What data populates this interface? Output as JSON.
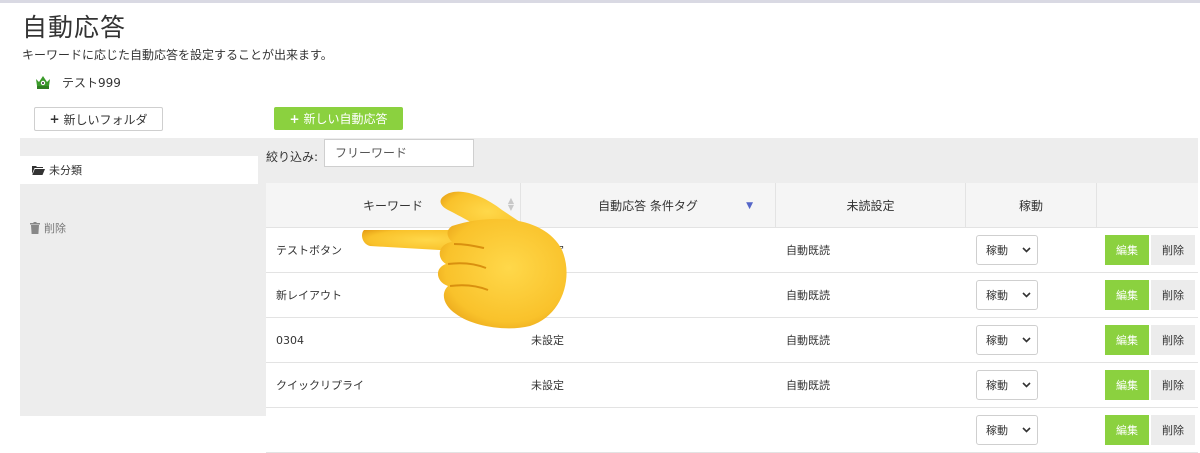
{
  "page": {
    "title": "自動応答",
    "subtitle": "キーワードに応じた自動応答を設定することが出来ます。"
  },
  "account": {
    "name": "テスト999",
    "icon": "green-crown-avatar-icon"
  },
  "toolbar": {
    "new_folder_label": "新しいフォルダ",
    "new_response_label": "新しい自動応答",
    "plus_icon": "+"
  },
  "sidebar": {
    "items": [
      {
        "label": "未分類",
        "icon": "folder-open-icon",
        "selected": true
      },
      {
        "label": "削除",
        "icon": "trash-icon",
        "selected": false
      }
    ]
  },
  "filter": {
    "label": "絞り込み:",
    "placeholder": "フリーワード",
    "value": ""
  },
  "table": {
    "headers": {
      "keyword": "キーワード",
      "tag": "自動応答 条件タグ",
      "read": "未読設定",
      "operation": "稼動",
      "actions": ""
    },
    "rows": [
      {
        "keyword": "テストボタン",
        "tag": "未設定",
        "read": "自動既読",
        "status": "稼動",
        "edit": "編集",
        "delete": "削除"
      },
      {
        "keyword": "新レイアウト",
        "tag": "",
        "read": "自動既読",
        "status": "稼動",
        "edit": "編集",
        "delete": "削除"
      },
      {
        "keyword": "0304",
        "tag": "未設定",
        "read": "自動既読",
        "status": "稼動",
        "edit": "編集",
        "delete": "削除"
      },
      {
        "keyword": "クイックリプライ",
        "tag": "未設定",
        "read": "自動既読",
        "status": "稼動",
        "edit": "編集",
        "delete": "削除"
      },
      {
        "keyword": "",
        "tag": "",
        "read": "",
        "status": "稼動",
        "edit": "編集",
        "delete": "削除"
      }
    ]
  },
  "colors": {
    "accent": "#8bd13f",
    "panel": "#ededed",
    "sort_active": "#5566c8"
  },
  "overlay": {
    "icon": "pointing-hand-emoji-icon"
  }
}
